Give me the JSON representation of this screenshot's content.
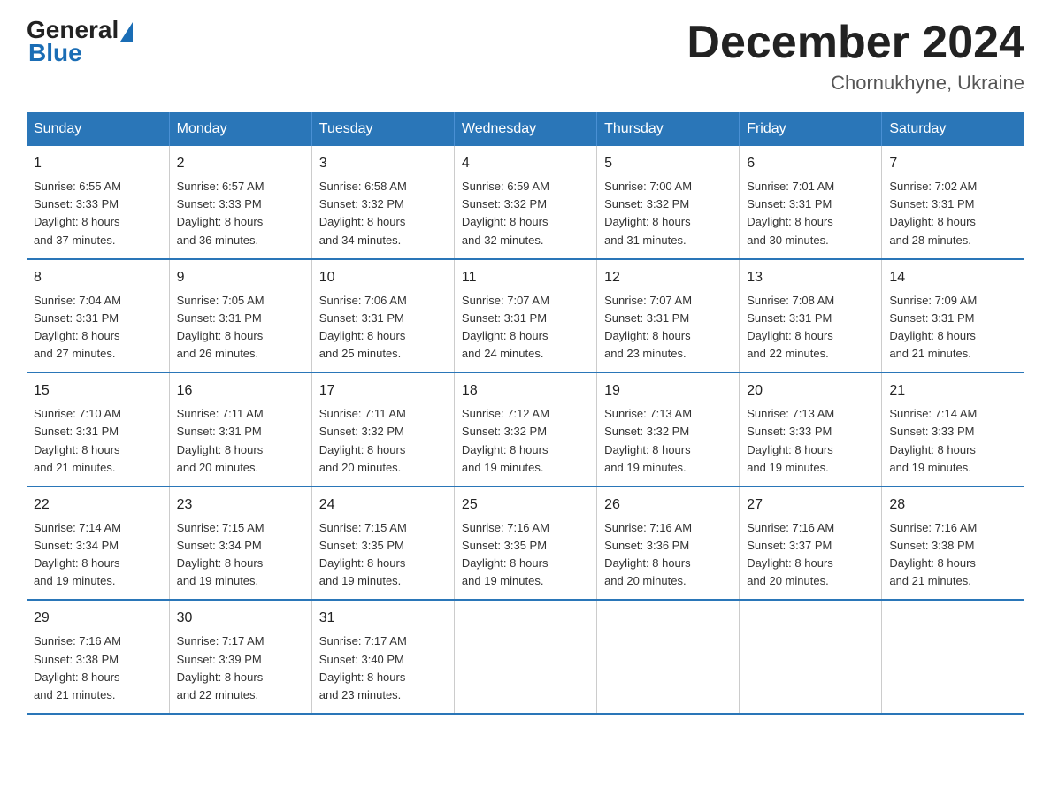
{
  "logo": {
    "general": "General",
    "blue": "Blue"
  },
  "title": {
    "month_year": "December 2024",
    "location": "Chornukhyne, Ukraine"
  },
  "days_of_week": [
    "Sunday",
    "Monday",
    "Tuesday",
    "Wednesday",
    "Thursday",
    "Friday",
    "Saturday"
  ],
  "weeks": [
    [
      {
        "day": "1",
        "sunrise": "6:55 AM",
        "sunset": "3:33 PM",
        "daylight": "8 hours and 37 minutes."
      },
      {
        "day": "2",
        "sunrise": "6:57 AM",
        "sunset": "3:33 PM",
        "daylight": "8 hours and 36 minutes."
      },
      {
        "day": "3",
        "sunrise": "6:58 AM",
        "sunset": "3:32 PM",
        "daylight": "8 hours and 34 minutes."
      },
      {
        "day": "4",
        "sunrise": "6:59 AM",
        "sunset": "3:32 PM",
        "daylight": "8 hours and 32 minutes."
      },
      {
        "day": "5",
        "sunrise": "7:00 AM",
        "sunset": "3:32 PM",
        "daylight": "8 hours and 31 minutes."
      },
      {
        "day": "6",
        "sunrise": "7:01 AM",
        "sunset": "3:31 PM",
        "daylight": "8 hours and 30 minutes."
      },
      {
        "day": "7",
        "sunrise": "7:02 AM",
        "sunset": "3:31 PM",
        "daylight": "8 hours and 28 minutes."
      }
    ],
    [
      {
        "day": "8",
        "sunrise": "7:04 AM",
        "sunset": "3:31 PM",
        "daylight": "8 hours and 27 minutes."
      },
      {
        "day": "9",
        "sunrise": "7:05 AM",
        "sunset": "3:31 PM",
        "daylight": "8 hours and 26 minutes."
      },
      {
        "day": "10",
        "sunrise": "7:06 AM",
        "sunset": "3:31 PM",
        "daylight": "8 hours and 25 minutes."
      },
      {
        "day": "11",
        "sunrise": "7:07 AM",
        "sunset": "3:31 PM",
        "daylight": "8 hours and 24 minutes."
      },
      {
        "day": "12",
        "sunrise": "7:07 AM",
        "sunset": "3:31 PM",
        "daylight": "8 hours and 23 minutes."
      },
      {
        "day": "13",
        "sunrise": "7:08 AM",
        "sunset": "3:31 PM",
        "daylight": "8 hours and 22 minutes."
      },
      {
        "day": "14",
        "sunrise": "7:09 AM",
        "sunset": "3:31 PM",
        "daylight": "8 hours and 21 minutes."
      }
    ],
    [
      {
        "day": "15",
        "sunrise": "7:10 AM",
        "sunset": "3:31 PM",
        "daylight": "8 hours and 21 minutes."
      },
      {
        "day": "16",
        "sunrise": "7:11 AM",
        "sunset": "3:31 PM",
        "daylight": "8 hours and 20 minutes."
      },
      {
        "day": "17",
        "sunrise": "7:11 AM",
        "sunset": "3:32 PM",
        "daylight": "8 hours and 20 minutes."
      },
      {
        "day": "18",
        "sunrise": "7:12 AM",
        "sunset": "3:32 PM",
        "daylight": "8 hours and 19 minutes."
      },
      {
        "day": "19",
        "sunrise": "7:13 AM",
        "sunset": "3:32 PM",
        "daylight": "8 hours and 19 minutes."
      },
      {
        "day": "20",
        "sunrise": "7:13 AM",
        "sunset": "3:33 PM",
        "daylight": "8 hours and 19 minutes."
      },
      {
        "day": "21",
        "sunrise": "7:14 AM",
        "sunset": "3:33 PM",
        "daylight": "8 hours and 19 minutes."
      }
    ],
    [
      {
        "day": "22",
        "sunrise": "7:14 AM",
        "sunset": "3:34 PM",
        "daylight": "8 hours and 19 minutes."
      },
      {
        "day": "23",
        "sunrise": "7:15 AM",
        "sunset": "3:34 PM",
        "daylight": "8 hours and 19 minutes."
      },
      {
        "day": "24",
        "sunrise": "7:15 AM",
        "sunset": "3:35 PM",
        "daylight": "8 hours and 19 minutes."
      },
      {
        "day": "25",
        "sunrise": "7:16 AM",
        "sunset": "3:35 PM",
        "daylight": "8 hours and 19 minutes."
      },
      {
        "day": "26",
        "sunrise": "7:16 AM",
        "sunset": "3:36 PM",
        "daylight": "8 hours and 20 minutes."
      },
      {
        "day": "27",
        "sunrise": "7:16 AM",
        "sunset": "3:37 PM",
        "daylight": "8 hours and 20 minutes."
      },
      {
        "day": "28",
        "sunrise": "7:16 AM",
        "sunset": "3:38 PM",
        "daylight": "8 hours and 21 minutes."
      }
    ],
    [
      {
        "day": "29",
        "sunrise": "7:16 AM",
        "sunset": "3:38 PM",
        "daylight": "8 hours and 21 minutes."
      },
      {
        "day": "30",
        "sunrise": "7:17 AM",
        "sunset": "3:39 PM",
        "daylight": "8 hours and 22 minutes."
      },
      {
        "day": "31",
        "sunrise": "7:17 AM",
        "sunset": "3:40 PM",
        "daylight": "8 hours and 23 minutes."
      },
      null,
      null,
      null,
      null
    ]
  ],
  "labels": {
    "sunrise_prefix": "Sunrise: ",
    "sunset_prefix": "Sunset: ",
    "daylight_prefix": "Daylight: "
  }
}
